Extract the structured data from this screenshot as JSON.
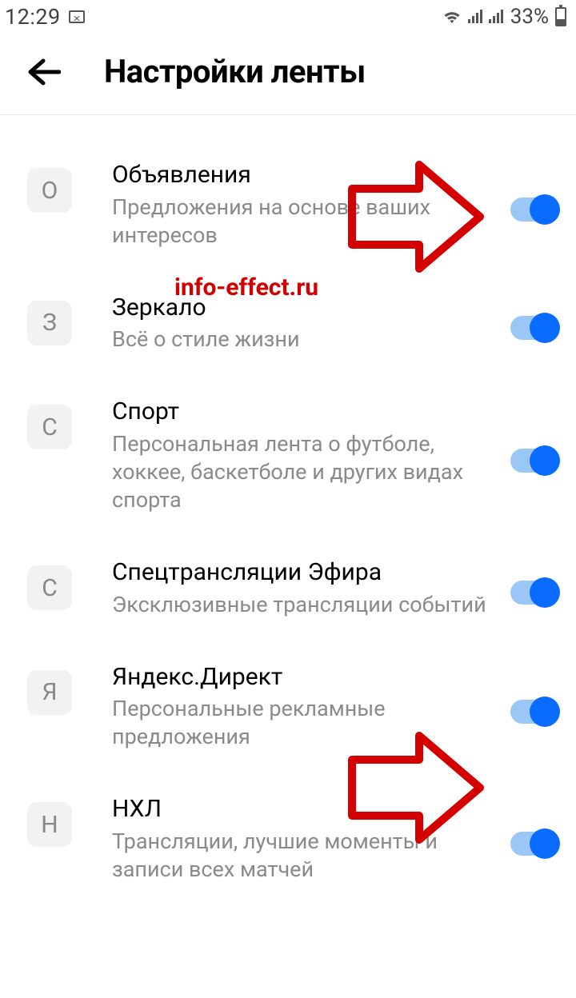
{
  "status": {
    "time": "12:29",
    "battery_pct": "33%"
  },
  "header": {
    "title": "Настройки ленты"
  },
  "watermark": "info-effect.ru",
  "items": [
    {
      "letter": "О",
      "title": "Объявления",
      "desc": "Предложения на основе ваших интересов",
      "on": true
    },
    {
      "letter": "З",
      "title": "Зеркало",
      "desc": "Всё о стиле жизни",
      "on": true
    },
    {
      "letter": "С",
      "title": "Спорт",
      "desc": "Персональная лента о футболе, хоккее, баскетболе и других видах спорта",
      "on": true
    },
    {
      "letter": "С",
      "title": "Спецтрансляции Эфира",
      "desc": "Эксклюзивные трансляции событий",
      "on": true
    },
    {
      "letter": "Я",
      "title": "Яндекс.Директ",
      "desc": "Персональные рекламные предложения",
      "on": true
    },
    {
      "letter": "Н",
      "title": "НХЛ",
      "desc": "Трансляции, лучшие моменты и записи всех матчей",
      "on": true
    }
  ]
}
